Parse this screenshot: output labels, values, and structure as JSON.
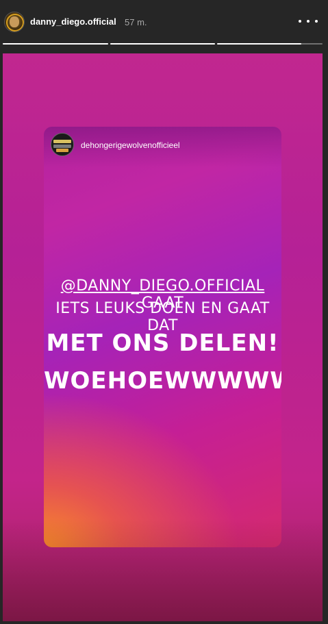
{
  "header": {
    "username": "danny_diego.official",
    "time": "57 m.",
    "more_icon": "more-horizontal-icon",
    "progress": [
      1.0,
      1.0,
      0.8
    ]
  },
  "card": {
    "handle": "dehongerigewolvenofficieel",
    "avatar_icon": "profile-avatar"
  },
  "story_text": {
    "mention": "@DANNY_DIEGO.OFFICIAL",
    "line1_rest": " GAAT",
    "line2": "IETS LEUKS DOEN EN GAAT DAT",
    "line3": "MET ONS DELEN!",
    "line4": "WOEHOEWWWWW"
  },
  "colors": {
    "background": "#262626",
    "story_gradient_top": "#c1278f",
    "card_accent_orange": "#f7892b",
    "card_accent_purple": "#a523b8"
  }
}
